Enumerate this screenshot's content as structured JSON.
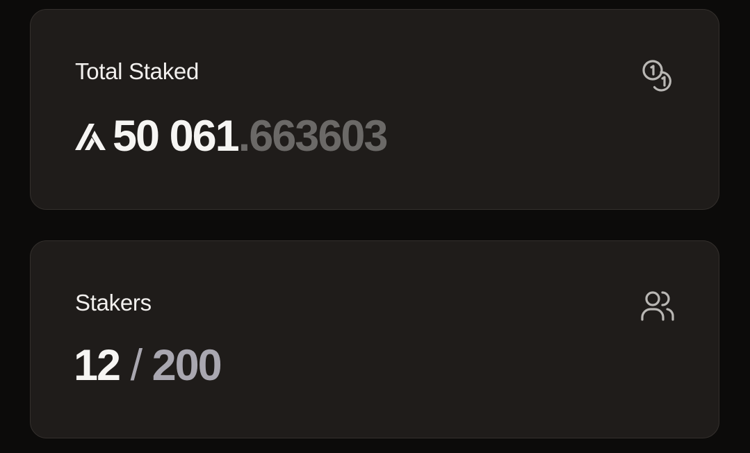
{
  "total_staked": {
    "label": "Total Staked",
    "icon": "coins-icon",
    "token_icon": "aptos-logo-icon",
    "amount_integer": "50 061",
    "amount_fraction": ".663603"
  },
  "stakers": {
    "label": "Stakers",
    "icon": "users-icon",
    "current": "12",
    "separator": " / ",
    "max": "200"
  },
  "colors": {
    "background": "#0c0b0a",
    "card": "#1f1c1a",
    "text": "#f6f5f3",
    "muted_fraction": "#6b6967",
    "muted_max": "#a9a7b0"
  }
}
